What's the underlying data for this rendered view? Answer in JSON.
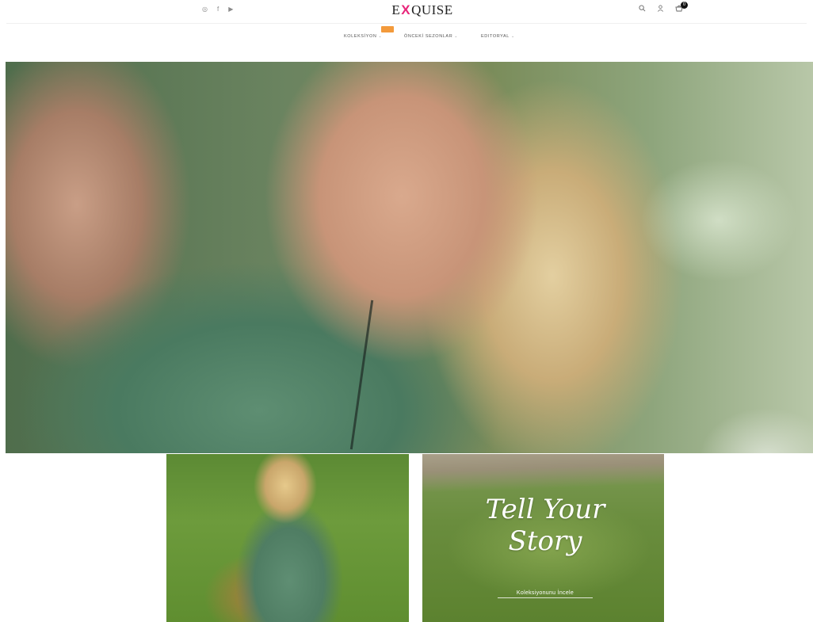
{
  "brand": {
    "logo_prefix": "E",
    "logo_x": "X",
    "logo_suffix": "QUISE",
    "accent_color": "#e8257a"
  },
  "header": {
    "social_icons": [
      "instagram-icon",
      "facebook-icon",
      "youtube-icon"
    ],
    "utility_icons": [
      "search-icon",
      "user-icon",
      "cart-icon"
    ],
    "cart_count": "0"
  },
  "nav": {
    "items": [
      {
        "label": "KOLEKSİYON"
      },
      {
        "label": "ÖNCEKİ SEZONLAR"
      },
      {
        "label": "EDITORYAL"
      }
    ],
    "badge_color": "#f39a3b"
  },
  "promo": {
    "title_line1": "Tell Your",
    "title_line2": "Story",
    "cta_label": "Koleksiyonunu İncele"
  }
}
